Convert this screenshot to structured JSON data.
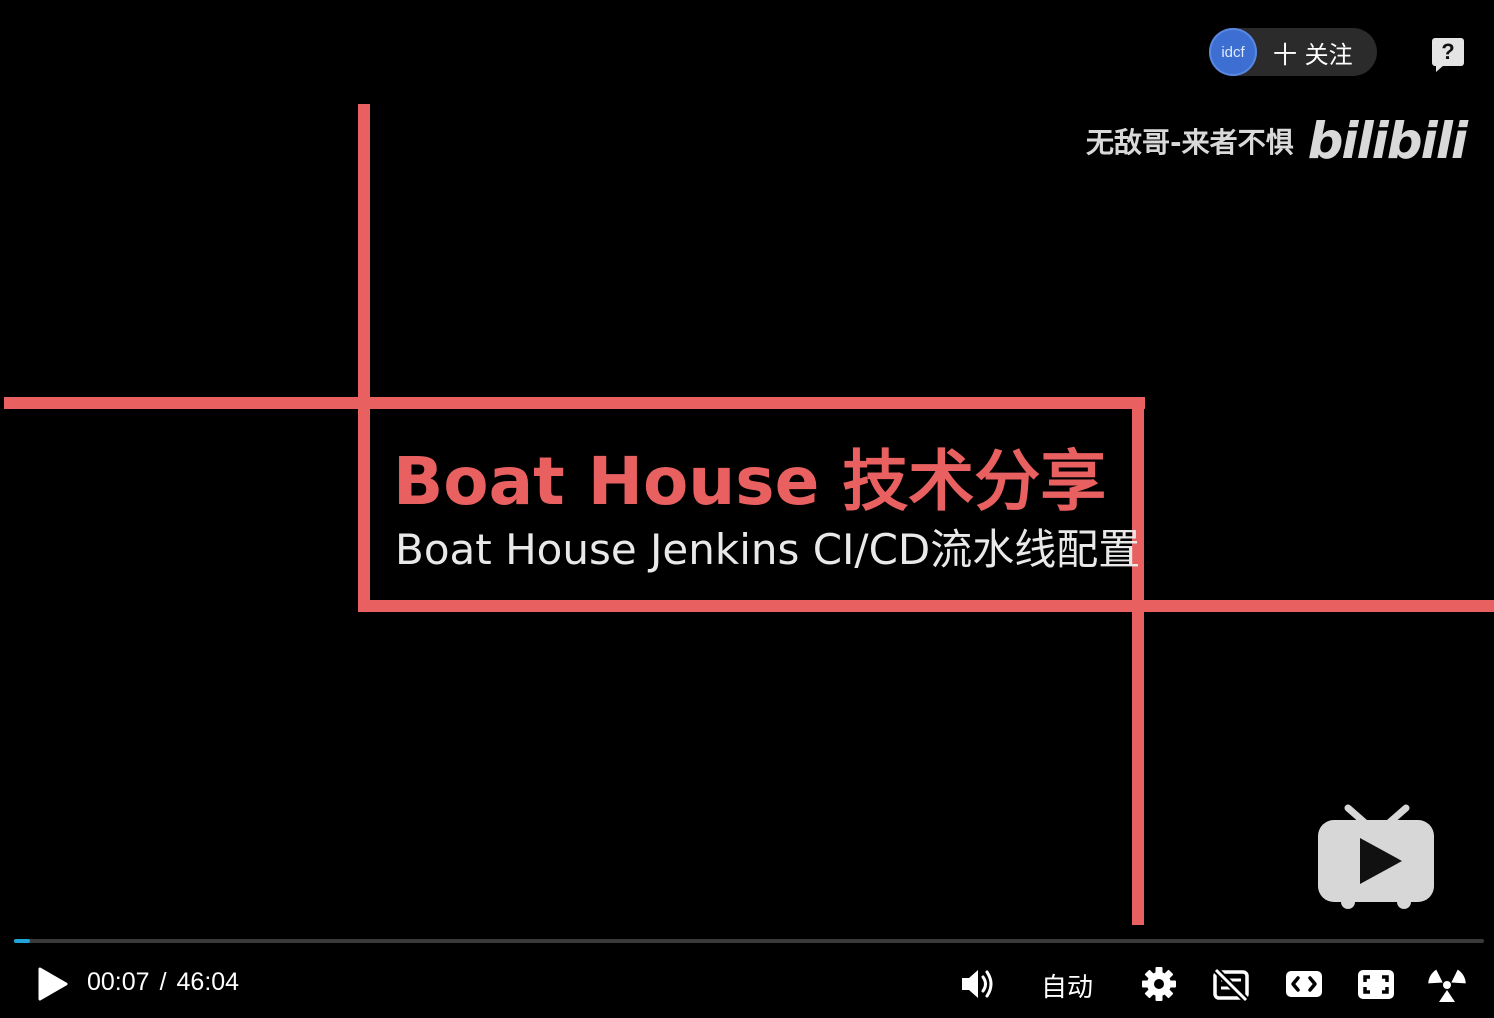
{
  "video": {
    "title_main": "Boat House 技术分享",
    "title_sub": "Boat House Jenkins CI/CD流水线配置",
    "watermark_user": "无敌哥-来者不惧",
    "watermark_logo": "bilibili"
  },
  "follow": {
    "avatar_text": "idcf",
    "label": "十 关注"
  },
  "help": {
    "label": "?"
  },
  "progress": {
    "fraction": 0.011
  },
  "controls": {
    "current_time": "00:07",
    "separator": "/",
    "duration": "46:04",
    "quality_label": "自动"
  },
  "colors": {
    "accent_red": "#e8605f",
    "progress_blue": "#1fa3d8"
  },
  "icons": [
    "play-icon",
    "volume-icon",
    "settings-icon",
    "danmaku-off-icon",
    "widescreen-icon",
    "fullscreen-icon",
    "radiation-icon",
    "tv-icon"
  ]
}
